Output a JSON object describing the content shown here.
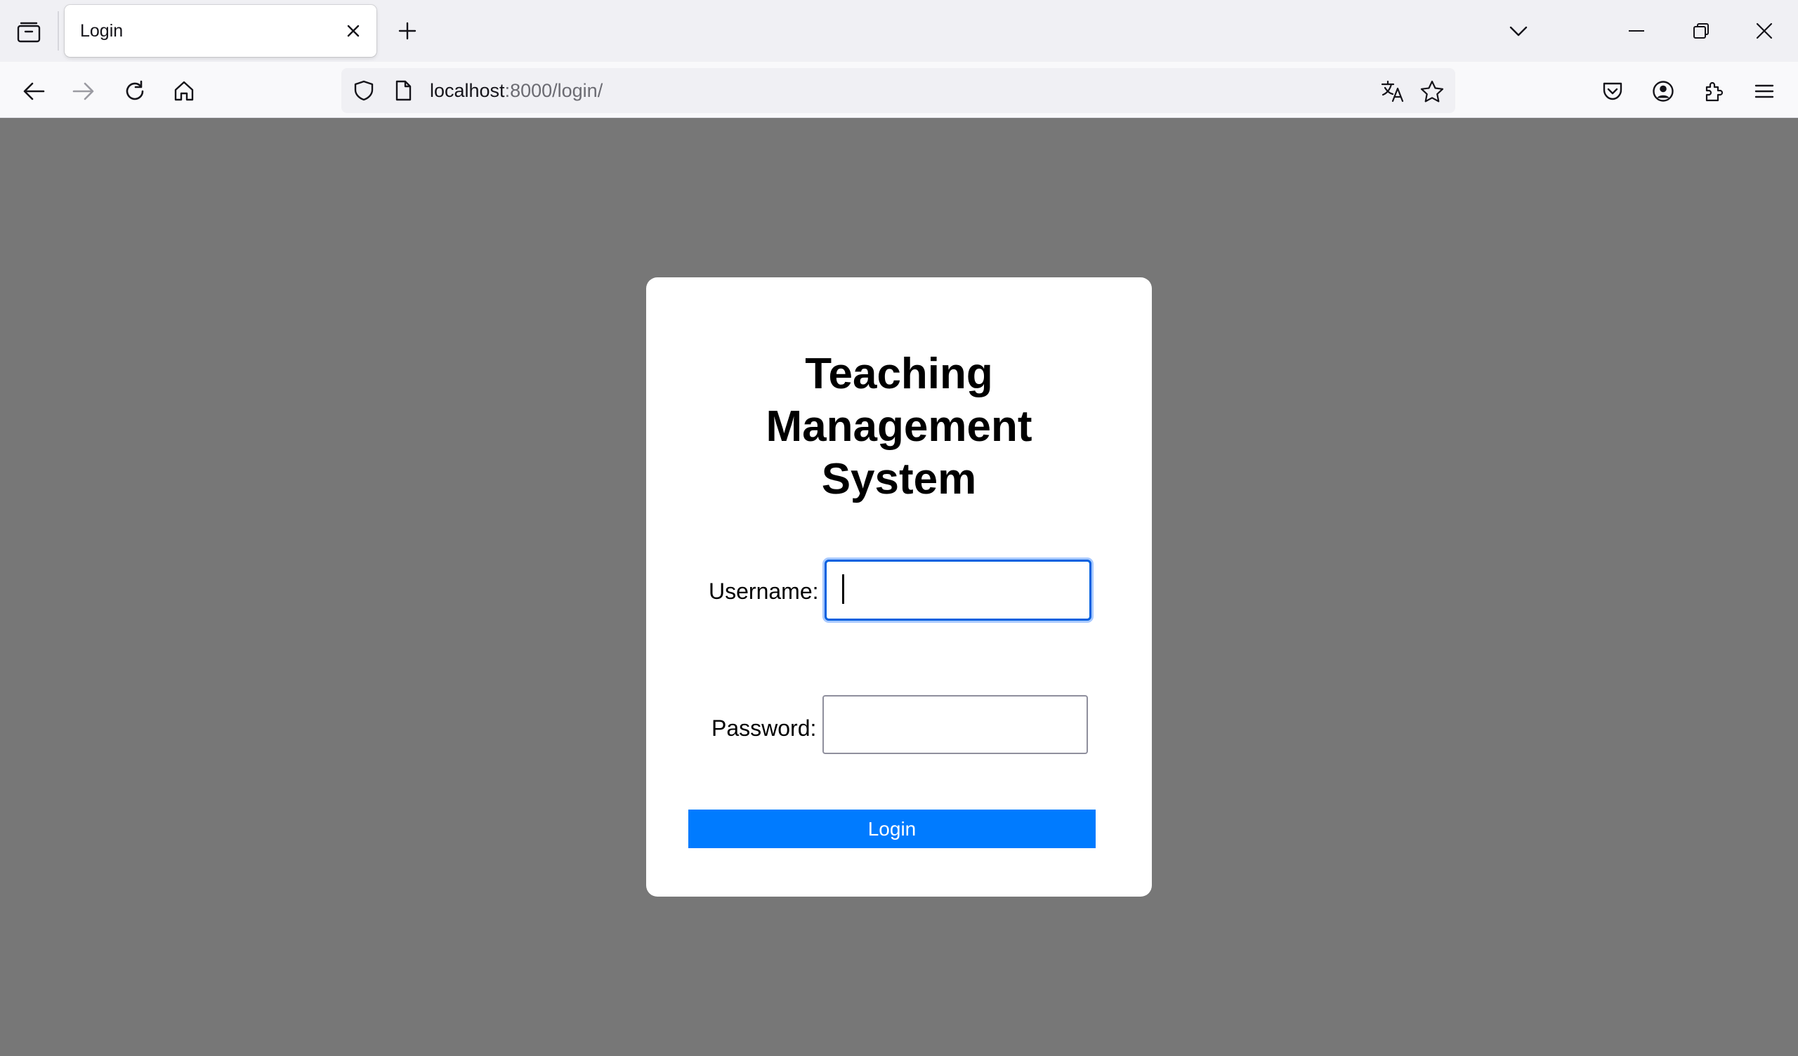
{
  "browser": {
    "tab": {
      "title": "Login"
    },
    "url": {
      "host": "localhost",
      "rest": ":8000/login/"
    }
  },
  "login_form": {
    "title_lines": [
      "Teaching",
      "Management",
      "System"
    ],
    "username_label": "Username:",
    "username_value": "",
    "password_label": "Password:",
    "password_value": "",
    "submit_label": "Login"
  },
  "colors": {
    "page_background": "#777777",
    "card_background": "#ffffff",
    "button_background": "#007bff",
    "focus_ring": "#0060df"
  }
}
